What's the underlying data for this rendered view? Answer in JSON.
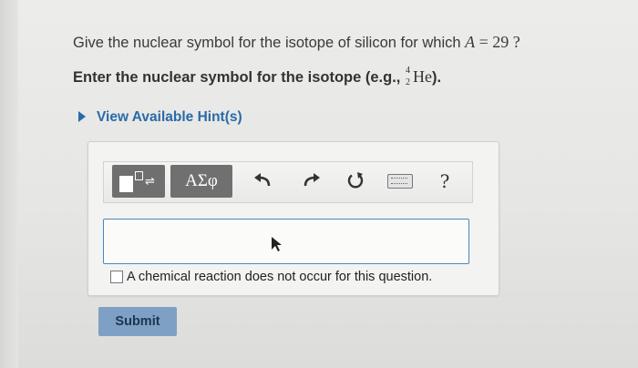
{
  "question": {
    "prefix": "Give the nuclear symbol for the isotope of silicon for which ",
    "variable": "A",
    "equals": " = 29 ?"
  },
  "instruction": {
    "text": "Enter the nuclear symbol for the isotope (e.g., ",
    "example_mass": "4",
    "example_atomic": "2",
    "example_symbol": "He",
    "suffix": ")."
  },
  "hint": {
    "label": "View Available Hint(s)"
  },
  "toolbar": {
    "greek_label": "ΑΣφ",
    "help_label": "?",
    "icons": [
      "templates-icon",
      "greek-letters-icon",
      "undo-icon",
      "redo-icon",
      "reset-icon",
      "keyboard-icon",
      "help-icon"
    ]
  },
  "answer": {
    "value": ""
  },
  "checkbox": {
    "label": "A chemical reaction does not occur for this question.",
    "checked": false
  },
  "submit": {
    "label": "Submit"
  },
  "colors": {
    "link": "#2a6aa8",
    "input_border": "#4b87b8",
    "submit_bg": "#7ea0c4",
    "toolbar_button_bg": "#707070"
  }
}
